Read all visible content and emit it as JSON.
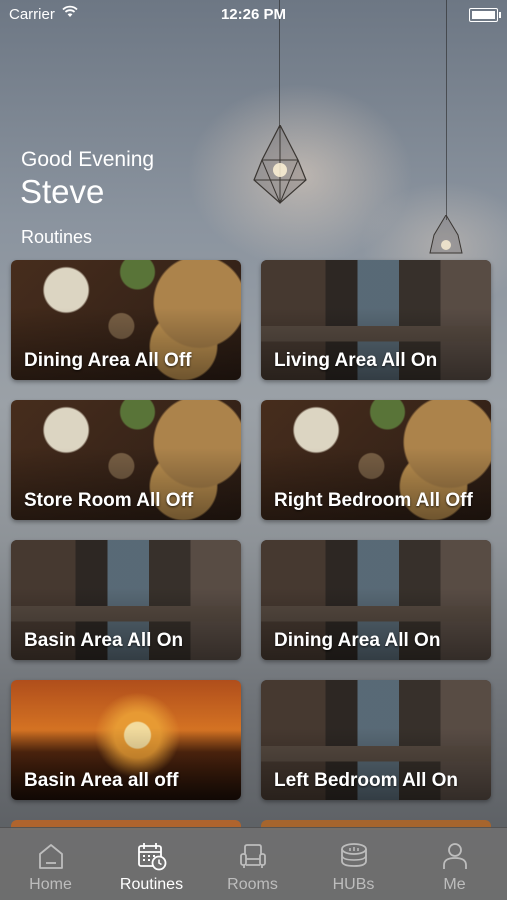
{
  "status_bar": {
    "carrier": "Carrier",
    "time": "12:26 PM"
  },
  "greeting": "Good Evening",
  "user_name": "Steve",
  "section_title": "Routines",
  "routines": [
    {
      "label": "Dining Area All Off",
      "image": "dining-table-photo"
    },
    {
      "label": "Living Area All On",
      "image": "living-room-photo"
    },
    {
      "label": "Store Room All Off",
      "image": "dining-table-photo"
    },
    {
      "label": "Right Bedroom All Off",
      "image": "dining-table-photo"
    },
    {
      "label": "Basin Area All On",
      "image": "living-room-photo"
    },
    {
      "label": "Dining Area All On",
      "image": "living-room-photo"
    },
    {
      "label": "Basin Area all off",
      "image": "sunset-photo"
    },
    {
      "label": "Left Bedroom All On",
      "image": "living-room-photo"
    }
  ],
  "tabs": [
    {
      "label": "Home",
      "icon": "home-icon",
      "active": false
    },
    {
      "label": "Routines",
      "icon": "calendar-clock-icon",
      "active": true
    },
    {
      "label": "Rooms",
      "icon": "armchair-icon",
      "active": false
    },
    {
      "label": "HUBs",
      "icon": "hub-icon",
      "active": false
    },
    {
      "label": "Me",
      "icon": "person-icon",
      "active": false
    }
  ]
}
